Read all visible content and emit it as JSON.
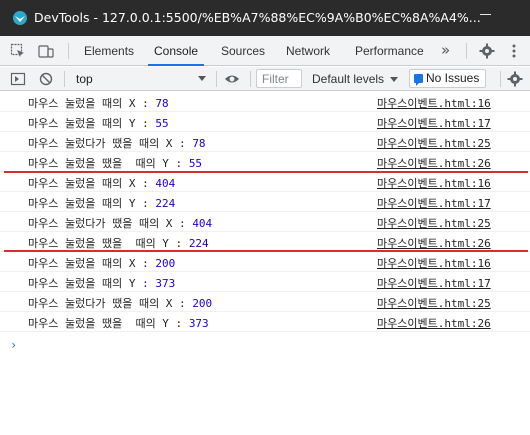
{
  "window": {
    "title": "DevTools - 127.0.0.1:5500/%EB%A7%88%EC%9A%B0%EC%8A%A4%...",
    "colors": {
      "titlebar": "#2b2b2b",
      "accent": "#1a73e8",
      "marker": "#d32f2f"
    }
  },
  "tabs": {
    "items": [
      "Elements",
      "Console",
      "Sources",
      "Network",
      "Performance"
    ],
    "active": "Console",
    "more": "»"
  },
  "toolbar": {
    "context": "top",
    "filter_placeholder": "Filter",
    "levels": "Default levels",
    "issues": "No Issues"
  },
  "console": {
    "logs": [
      {
        "msg": "마우스 눌렀을 때의 X :",
        "val": "78",
        "src": "마우스이벤트.html:16"
      },
      {
        "msg": "마우스 눌렀을 때의 Y :",
        "val": "55",
        "src": "마우스이벤트.html:17"
      },
      {
        "msg": "마우스 눌렀다가 땠을 때의 X :",
        "val": "78",
        "src": "마우스이벤트.html:25"
      },
      {
        "msg": "마우스 눌렀을 땠을  때의 Y :",
        "val": "55",
        "src": "마우스이벤트.html:26"
      },
      {
        "msg": "마우스 눌렀을 때의 X :",
        "val": "404",
        "src": "마우스이벤트.html:16"
      },
      {
        "msg": "마우스 눌렀을 때의 Y :",
        "val": "224",
        "src": "마우스이벤트.html:17"
      },
      {
        "msg": "마우스 눌렀다가 땠을 때의 X :",
        "val": "404",
        "src": "마우스이벤트.html:25"
      },
      {
        "msg": "마우스 눌렀을 땠을  때의 Y :",
        "val": "224",
        "src": "마우스이벤트.html:26"
      },
      {
        "msg": "마우스 눌렀을 때의 X :",
        "val": "200",
        "src": "마우스이벤트.html:16"
      },
      {
        "msg": "마우스 눌렀을 때의 Y :",
        "val": "373",
        "src": "마우스이벤트.html:17"
      },
      {
        "msg": "마우스 눌렀다가 땠을 때의 X :",
        "val": "200",
        "src": "마우스이벤트.html:25"
      },
      {
        "msg": "마우스 눌렀을 땠을  때의 Y :",
        "val": "373",
        "src": "마우스이벤트.html:26"
      }
    ],
    "prompt": "›"
  }
}
